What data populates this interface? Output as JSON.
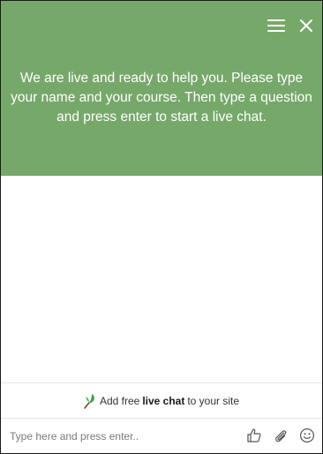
{
  "header": {
    "greeting": "We are live and ready to help you. Please type your name and your course. Then type a question and press enter to start a live chat.",
    "background_color": "#76a86a",
    "menu_icon": "hamburger-menu-icon",
    "close_icon": "close-icon"
  },
  "promo": {
    "prefix": "Add free",
    "link": "live chat",
    "suffix": "to your site",
    "icon": "leaf-logo-icon"
  },
  "input": {
    "placeholder": "Type here and press enter.."
  },
  "tools": {
    "like_icon": "thumbs-up-icon",
    "attach_icon": "paperclip-icon",
    "emoji_icon": "smiley-icon"
  }
}
